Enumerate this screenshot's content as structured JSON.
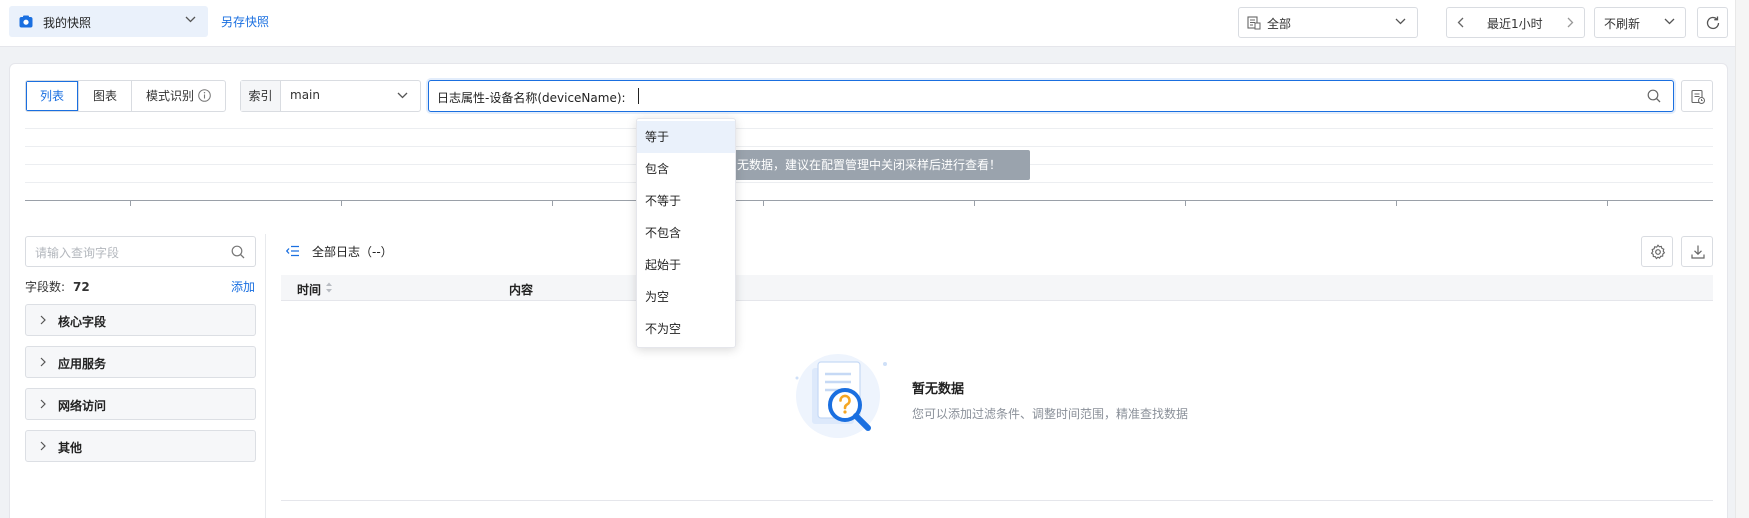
{
  "header": {
    "snapshot_select": "我的快照",
    "save_as_link": "另存快照",
    "scope_select": "全部",
    "time_range": "最近1小时",
    "refresh_select": "不刷新"
  },
  "toolbar": {
    "tabs": [
      {
        "label": "列表",
        "active": true
      },
      {
        "label": "图表",
        "active": false
      },
      {
        "label": "模式识别",
        "active": false
      }
    ],
    "index_label": "索引",
    "index_value": "main",
    "query_text": "日志属性-设备名称(deviceName):"
  },
  "histogram": {
    "notice": "无数据，建议在配置管理中关闭采样后进行查看！"
  },
  "operator_dropdown": {
    "items": [
      "等于",
      "包含",
      "不等于",
      "不包含",
      "起始于",
      "为空",
      "不为空"
    ],
    "highlighted": "等于"
  },
  "fields_panel": {
    "search_placeholder": "请输入查询字段",
    "count_label": "字段数:",
    "count_value": "72",
    "add_link": "添加",
    "groups": [
      "核心字段",
      "应用服务",
      "网络访问",
      "其他"
    ]
  },
  "log_panel": {
    "title": "全部日志（--）",
    "columns": [
      "时间",
      "内容"
    ],
    "empty_title": "暂无数据",
    "empty_desc": "您可以添加过滤条件、调整时间范围，精准查找数据"
  },
  "colors": {
    "accent": "#1a6fe0",
    "tooltip_bg": "#9aa3ad",
    "highlight_bg": "#eaf1fb"
  }
}
